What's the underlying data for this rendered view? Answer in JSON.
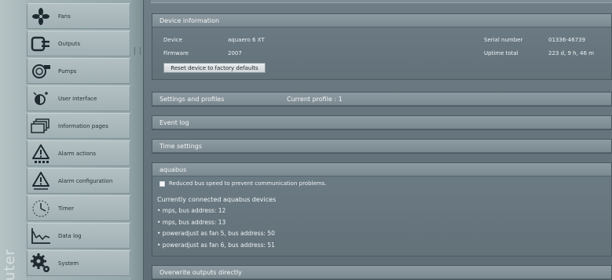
{
  "sidebar": {
    "vertical_text": "uter",
    "items": [
      {
        "label": "Fans",
        "icon": "fan-icon"
      },
      {
        "label": "Outputs",
        "icon": "plug-icon"
      },
      {
        "label": "Pumps",
        "icon": "pump-icon"
      },
      {
        "label": "User interface",
        "icon": "brightness-icon"
      },
      {
        "label": "Information pages",
        "icon": "pages-icon"
      },
      {
        "label": "Alarm actions",
        "icon": "warning-icon"
      },
      {
        "label": "Alarm configuration",
        "icon": "warning-config-icon"
      },
      {
        "label": "Timer",
        "icon": "clock-icon"
      },
      {
        "label": "Data log",
        "icon": "chart-icon"
      },
      {
        "label": "System",
        "icon": "gears-icon"
      }
    ]
  },
  "device_info": {
    "title": "Device information",
    "device_label": "Device",
    "device_value": "aquaero 6 XT",
    "firmware_label": "Firmware",
    "firmware_value": "2007",
    "serial_label": "Serial number",
    "serial_value": "01336-46739",
    "uptime_label": "Uptime total",
    "uptime_value": "223 d, 9 h, 46 m",
    "reset_button": "Reset device to factory defaults"
  },
  "settings_profiles": {
    "title": "Settings and profiles",
    "current_profile": "Current profile : 1"
  },
  "event_log": {
    "title": "Event log"
  },
  "time_settings": {
    "title": "Time settings"
  },
  "aquabus": {
    "title": "aquabus",
    "reduced_speed_label": "Reduced bus speed to prevent communication problems.",
    "reduced_speed_checked": false,
    "connected_title": "Currently connected aquabus devices",
    "devices": [
      "• mps, bus address: 12",
      "• mps, bus address: 13",
      "• poweradjust as fan 5, bus address: 50",
      "• poweradjust as fan 6, bus address: 51"
    ]
  },
  "overwrite_outputs": {
    "title": "Overwrite outputs directly"
  }
}
